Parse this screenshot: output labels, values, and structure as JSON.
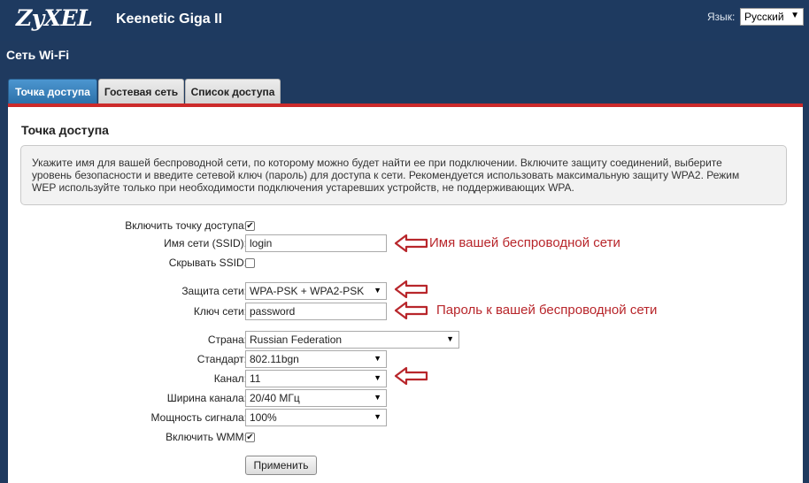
{
  "header": {
    "logo": "ZyXEL",
    "model": "Keenetic Giga II",
    "language_label": "Язык:",
    "language_value": "Русский"
  },
  "page_title": "Сеть Wi-Fi",
  "tabs": [
    {
      "label": "Точка доступа",
      "active": true
    },
    {
      "label": "Гостевая сеть",
      "active": false
    },
    {
      "label": "Список доступа",
      "active": false
    }
  ],
  "section": {
    "title": "Точка доступа",
    "info_lines": [
      "Укажите имя для вашей беспроводной сети, по которому можно будет найти ее при подключении. Включите защиту соединений, выберите",
      "уровень безопасности и введите сетевой ключ (пароль) для доступа к сети. Рекомендуется использовать максимальную защиту WPA2. Режим",
      "WEP используйте только при необходимости подключения устаревших устройств, не поддерживающих WPA."
    ]
  },
  "form": {
    "enable_ap": {
      "label": "Включить точку доступа:",
      "checked": true
    },
    "ssid": {
      "label": "Имя сети (SSID):",
      "value": "login"
    },
    "hide_ssid": {
      "label": "Скрывать SSID:",
      "checked": false
    },
    "security": {
      "label": "Защита сети:",
      "value": "WPA-PSK + WPA2-PSK"
    },
    "key": {
      "label": "Ключ сети:",
      "value": "password"
    },
    "country": {
      "label": "Страна:",
      "value": "Russian Federation"
    },
    "standard": {
      "label": "Стандарт:",
      "value": "802.11bgn"
    },
    "channel": {
      "label": "Канал:",
      "value": "11"
    },
    "width": {
      "label": "Ширина канала:",
      "value": "20/40 МГц"
    },
    "power": {
      "label": "Мощность сигнала:",
      "value": "100%"
    },
    "wmm": {
      "label": "Включить WMM:",
      "checked": true
    },
    "apply_label": "Применить"
  },
  "annotations": {
    "ssid_note": "Имя вашей беспроводной сети",
    "key_note": "Пароль к вашей беспроводной сети"
  },
  "icons": {
    "checkbox_checked": "✔",
    "dropdown_arrow": "▼"
  },
  "colors": {
    "header_bg": "#1e3a60",
    "accent_red": "#cc2a2a",
    "annotation_red": "#b8262b",
    "active_tab": "#3a82c0"
  }
}
